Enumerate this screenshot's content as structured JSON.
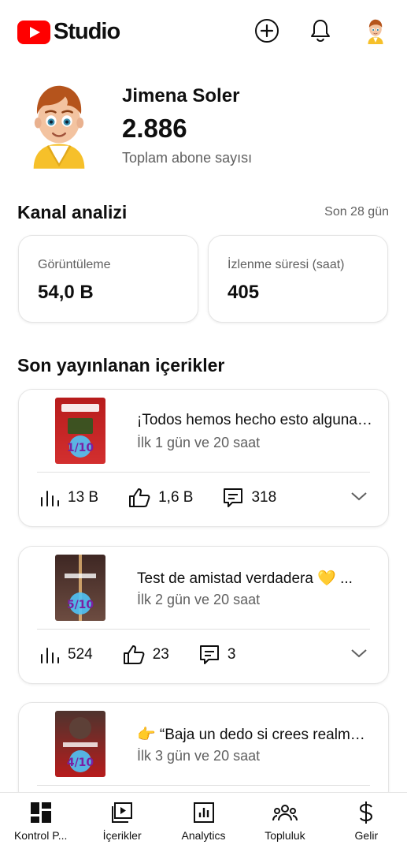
{
  "header": {
    "brand": "Studio",
    "icons": [
      "youtube-logo-icon",
      "create-icon",
      "notifications-icon",
      "avatar"
    ]
  },
  "profile": {
    "name": "Jimena Soler",
    "subscribers": "2.886",
    "subscribers_label": "Toplam abone sayısı"
  },
  "analytics": {
    "title": "Kanal analizi",
    "period": "Son 28 gün",
    "stats": [
      {
        "label": "Görüntüleme",
        "value": "54,0 B"
      },
      {
        "label": "İzlenme süresi (saat)",
        "value": "405"
      }
    ]
  },
  "recent": {
    "title": "Son yayınlanan içerikler",
    "videos": [
      {
        "title": "¡Todos hemos hecho esto alguna vez!",
        "age": "İlk 1 gün ve 20 saat",
        "views": "13 B",
        "likes": "1,6 B",
        "comments": "318",
        "thumb_text": "1/10",
        "thumb_bg": "#c62828"
      },
      {
        "title": "Test de amistad verdadera 💛 ...",
        "age": "İlk 2 gün ve 20 saat",
        "views": "524",
        "likes": "23",
        "comments": "3",
        "thumb_text": "5/10",
        "thumb_bg": "#3e2723"
      },
      {
        "title": "👉 “Baja un dedo si crees realmente...",
        "age": "İlk 3 gün ve 20 saat",
        "views": "",
        "likes": "",
        "comments": "",
        "thumb_text": "4/10",
        "thumb_bg": "#b71c1c"
      }
    ]
  },
  "nav": {
    "items": [
      {
        "label": "Kontrol P...",
        "icon": "dashboard-icon"
      },
      {
        "label": "İçerikler",
        "icon": "content-icon"
      },
      {
        "label": "Analytics",
        "icon": "analytics-icon"
      },
      {
        "label": "Topluluk",
        "icon": "community-icon"
      },
      {
        "label": "Gelir",
        "icon": "earn-icon"
      }
    ]
  },
  "colors": {
    "brand_red": "#ff0000",
    "secondary_text": "#606060",
    "primary_text": "#0f0f0f"
  }
}
